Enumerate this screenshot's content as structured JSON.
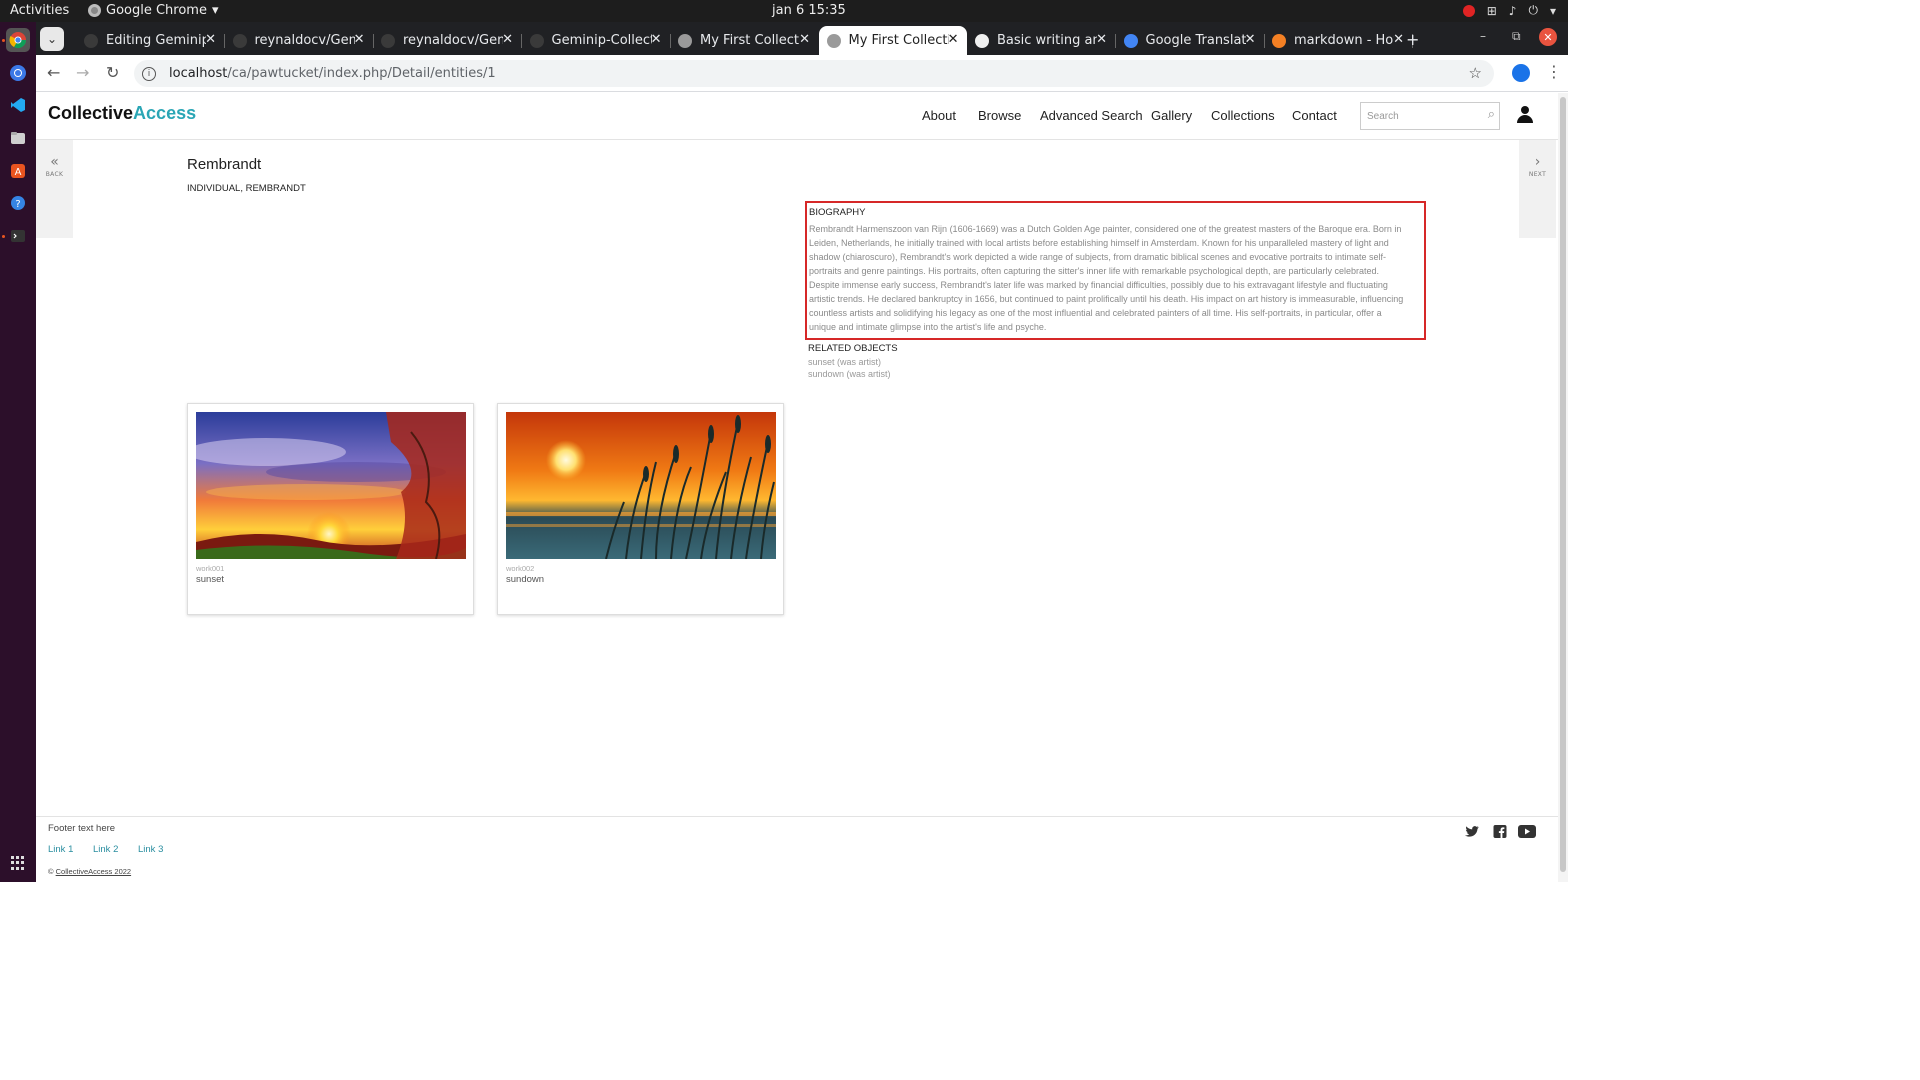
{
  "os": {
    "activities": "Activities",
    "app_name": "Google Chrome",
    "clock": "jan 6  15:35"
  },
  "browser": {
    "tabs": [
      {
        "label": "Editing Geminip",
        "favicon_color": "#3a3a3a"
      },
      {
        "label": "reynaldocv/Gem",
        "favicon_color": "#3a3a3a"
      },
      {
        "label": "reynaldocv/Gem",
        "favicon_color": "#3a3a3a"
      },
      {
        "label": "Geminip-Collect",
        "favicon_color": "#3a3a3a"
      },
      {
        "label": "My First Collecti",
        "favicon_color": "#9a9a9a"
      },
      {
        "label": "My First Collecti",
        "favicon_color": "#9a9a9a"
      },
      {
        "label": "Basic writing an",
        "favicon_color": "#f0f0f0"
      },
      {
        "label": "Google Translat",
        "favicon_color": "#4285f4"
      },
      {
        "label": "markdown - How",
        "favicon_color": "#f48024"
      }
    ],
    "active_tab_index": 5,
    "url_host": "localhost",
    "url_path": "/ca/pawtucket/index.php/Detail/entities/1"
  },
  "site": {
    "logo_part1": "Collective",
    "logo_part2": "Access",
    "accent_color": "#2aa6b5",
    "nav": [
      "About",
      "Browse",
      "Advanced Search",
      "Gallery",
      "Collections",
      "Contact"
    ],
    "search_placeholder": "Search",
    "back_label": "BACK",
    "next_label": "NEXT"
  },
  "entity": {
    "name": "Rembrandt",
    "type_line": "INDIVIDUAL, REMBRANDT",
    "biography_label": "BIOGRAPHY",
    "biography": "Rembrandt Harmenszoon van Rijn (1606-1669) was a Dutch Golden Age painter, considered one of the greatest masters of the Baroque era. Born in Leiden, Netherlands, he initially trained with local artists before establishing himself in Amsterdam. Known for his unparalleled mastery of light and shadow (chiaroscuro), Rembrandt's work depicted a wide range of subjects, from dramatic biblical scenes and evocative portraits to intimate self-portraits and genre paintings. His portraits, often capturing the sitter's inner life with remarkable psychological depth, are particularly celebrated. Despite immense early success, Rembrandt's later life was marked by financial difficulties, possibly due to his extravagant lifestyle and fluctuating artistic trends. He declared bankruptcy in 1656, but continued to paint prolifically until his death. His impact on art history is immeasurable, influencing countless artists and solidifying his legacy as one of the most influential and celebrated painters of all time. His self-portraits, in particular, offer a unique and intimate glimpse into the artist's life and psyche.",
    "related_label": "RELATED OBJECTS",
    "related": [
      {
        "name": "sunset",
        "role": "(was artist)"
      },
      {
        "name": "sundown",
        "role": "(was artist)"
      }
    ]
  },
  "objects": [
    {
      "idno": "work001",
      "name": "sunset"
    },
    {
      "idno": "work002",
      "name": "sundown"
    }
  ],
  "footer": {
    "text": "Footer text here",
    "links": [
      "Link 1",
      "Link 2",
      "Link 3"
    ],
    "copyright_prefix": "©",
    "copyright_link": "CollectiveAccess 2022"
  }
}
